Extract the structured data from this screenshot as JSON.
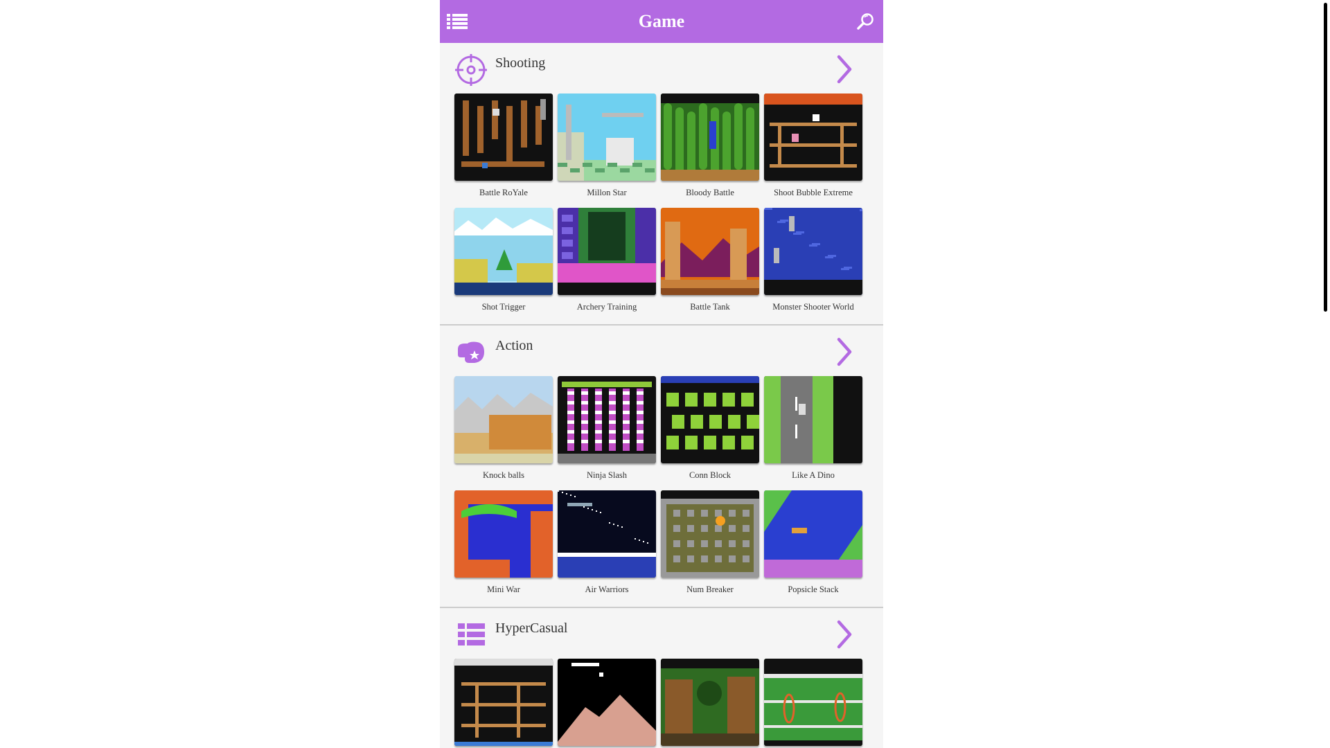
{
  "colors": {
    "accent": "#b36ae2",
    "header_text": "#ffffff"
  },
  "header": {
    "title": "Game",
    "menu_icon": "list-menu-icon",
    "search_icon": "search-icon"
  },
  "sections": [
    {
      "title": "Shooting",
      "icon": "crosshair-icon",
      "more_icon": "chevron-right-icon",
      "games": [
        {
          "label": "Battle RoYale",
          "thumb": "maze"
        },
        {
          "label": "Millon Star",
          "thumb": "sky"
        },
        {
          "label": "Bloody Battle",
          "thumb": "jungle"
        },
        {
          "label": "Shoot Bubble Extreme",
          "thumb": "ladders"
        },
        {
          "label": "Shot Trigger",
          "thumb": "snow"
        },
        {
          "label": "Archery Training",
          "thumb": "pinkcity"
        },
        {
          "label": "Battle Tank",
          "thumb": "sunset"
        },
        {
          "label": "Monster Shooter World",
          "thumb": "ocean"
        }
      ]
    },
    {
      "title": "Action",
      "icon": "boxing-glove-icon",
      "more_icon": "chevron-right-icon",
      "games": [
        {
          "label": "Knock balls",
          "thumb": "mountains"
        },
        {
          "label": "Ninja Slash",
          "thumb": "pillars"
        },
        {
          "label": "Conn Block",
          "thumb": "greenmaze"
        },
        {
          "label": "Like A Dino",
          "thumb": "road"
        },
        {
          "label": "Mini War",
          "thumb": "cave"
        },
        {
          "label": "Air Warriors",
          "thumb": "space"
        },
        {
          "label": "Num Breaker",
          "thumb": "bomber"
        },
        {
          "label": "Popsicle Stack",
          "thumb": "river"
        }
      ]
    },
    {
      "title": "HyperCasual",
      "icon": "grid-list-icon",
      "more_icon": "chevron-right-icon",
      "games": [
        {
          "label": "",
          "thumb": "scaffold"
        },
        {
          "label": "",
          "thumb": "nightpeak"
        },
        {
          "label": "",
          "thumb": "forest"
        },
        {
          "label": "",
          "thumb": "circus"
        }
      ]
    }
  ]
}
